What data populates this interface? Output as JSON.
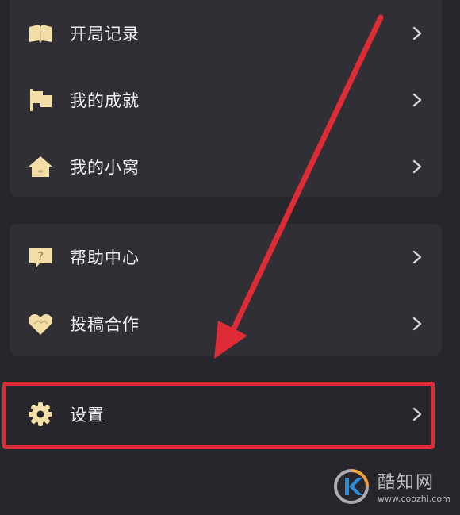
{
  "menu_group_1": {
    "items": [
      {
        "label": "开局记录",
        "icon": "book-icon"
      },
      {
        "label": "我的成就",
        "icon": "flag-icon"
      },
      {
        "label": "我的小窝",
        "icon": "house-icon"
      }
    ]
  },
  "menu_group_2": {
    "items": [
      {
        "label": "帮助中心",
        "icon": "help-icon"
      },
      {
        "label": "投稿合作",
        "icon": "handshake-heart-icon"
      }
    ]
  },
  "settings": {
    "label": "设置",
    "icon": "gear-icon"
  },
  "watermark": {
    "name": "酷知网",
    "url": "www.coozhi.com"
  },
  "colors": {
    "background": "#27262c",
    "card": "#302f36",
    "icon_gold": "#f3dfa6",
    "annotation_red": "#df2b35"
  }
}
